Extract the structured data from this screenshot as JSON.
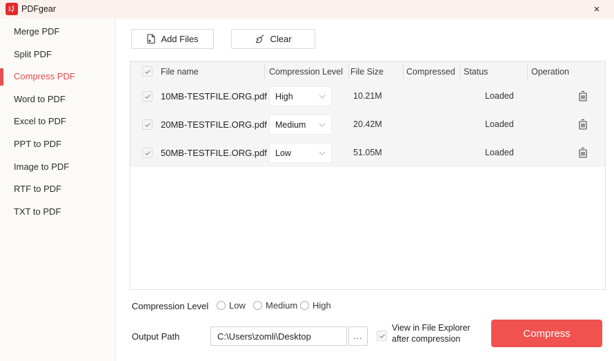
{
  "window": {
    "title": "PDFgear",
    "close_glyph": "×"
  },
  "sidebar": {
    "items": [
      {
        "label": "Merge PDF",
        "active": false
      },
      {
        "label": "Split PDF",
        "active": false
      },
      {
        "label": "Compress PDF",
        "active": true
      },
      {
        "label": "Word to PDF",
        "active": false
      },
      {
        "label": "Excel to PDF",
        "active": false
      },
      {
        "label": "PPT to PDF",
        "active": false
      },
      {
        "label": "Image to PDF",
        "active": false
      },
      {
        "label": "RTF to PDF",
        "active": false
      },
      {
        "label": "TXT to PDF",
        "active": false
      }
    ]
  },
  "toolbar": {
    "add_files_label": "Add Files",
    "clear_label": "Clear"
  },
  "table": {
    "headers": {
      "file_name": "File name",
      "compression_level": "Compression Level",
      "file_size": "File Size",
      "compressed": "Compressed",
      "status": "Status",
      "operation": "Operation"
    },
    "rows": [
      {
        "checked": true,
        "file_name": "10MB-TESTFILE.ORG.pdf",
        "compression_level": "High",
        "file_size": "10.21M",
        "compressed": "",
        "status": "Loaded"
      },
      {
        "checked": true,
        "file_name": "20MB-TESTFILE.ORG.pdf",
        "compression_level": "Medium",
        "file_size": "20.42M",
        "compressed": "",
        "status": "Loaded"
      },
      {
        "checked": true,
        "file_name": "50MB-TESTFILE.ORG.pdf",
        "compression_level": "Low",
        "file_size": "51.05M",
        "compressed": "",
        "status": "Loaded"
      }
    ]
  },
  "footer": {
    "compression_level_label": "Compression Level",
    "radio_options": [
      {
        "label": "Low",
        "selected": false
      },
      {
        "label": "Medium",
        "selected": false
      },
      {
        "label": "High",
        "selected": false
      }
    ],
    "output_path_label": "Output Path",
    "output_path_value": "C:\\Users\\zomli\\Desktop",
    "browse_label": "...",
    "view_label_line1": "View in File Explorer",
    "view_label_line2": "after compression",
    "view_checked": true,
    "compress_label": "Compress"
  },
  "colors": {
    "accent_red": "#f0524f",
    "titlebar_pink": "#fdf1ee",
    "table_gray": "#f5f5f6",
    "sidebar_active_red": "#e8504d"
  }
}
